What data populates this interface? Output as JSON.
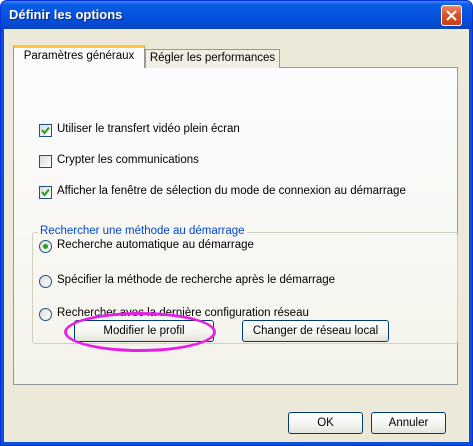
{
  "window": {
    "title": "Définir les options",
    "close_icon": "close-icon"
  },
  "tabs": [
    {
      "label": "Paramètres généraux",
      "active": true
    },
    {
      "label": "Régler les performances",
      "active": false
    }
  ],
  "options": {
    "fullscreen_video": {
      "label": "Utiliser le transfert vidéo plein écran",
      "checked": true
    },
    "encrypt_comms": {
      "label": "Crypter les communications",
      "checked": false
    },
    "show_connection_mode": {
      "label": "Afficher la fenêtre de sélection du mode de connexion au démarrage",
      "checked": true
    }
  },
  "search_group": {
    "title": "Rechercher une méthode au démarrage",
    "radios": [
      {
        "label": "Recherche automatique au démarrage",
        "selected": true
      },
      {
        "label": "Spécifier la méthode de recherche après le démarrage",
        "selected": false
      },
      {
        "label": "Rechercher avec la dernière configuration réseau",
        "selected": false
      }
    ]
  },
  "buttons": {
    "modify_profile": "Modifier le profil",
    "change_network": "Changer de réseau local",
    "ok": "OK",
    "cancel": "Annuler"
  },
  "colors": {
    "titlebar": "#0553e0",
    "dialog_bg": "#ece9d8",
    "group_title": "#0046d5",
    "highlight_annotation": "#e81ee8",
    "check_mark": "#21a121"
  }
}
